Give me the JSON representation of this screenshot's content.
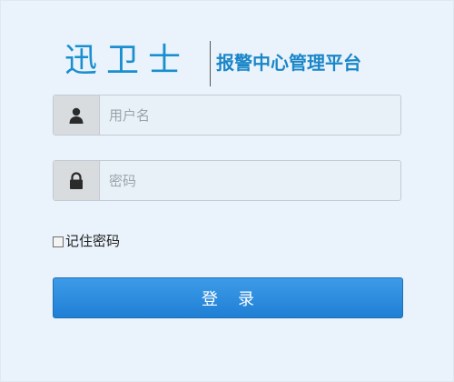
{
  "brand": {
    "logo_text": "迅卫士",
    "subtitle": "报警中心管理平台"
  },
  "login_form": {
    "username": {
      "placeholder": "用户名",
      "value": "",
      "icon": "user-icon"
    },
    "password": {
      "placeholder": "密码",
      "value": "",
      "icon": "lock-icon"
    },
    "remember_label": "记住密码",
    "remember_checked": false,
    "submit_label": "登录"
  },
  "colors": {
    "background": "#eaf3fb",
    "brand_blue": "#1a8fd0",
    "button_top": "#3d9be8",
    "button_bottom": "#1f7fd4"
  }
}
